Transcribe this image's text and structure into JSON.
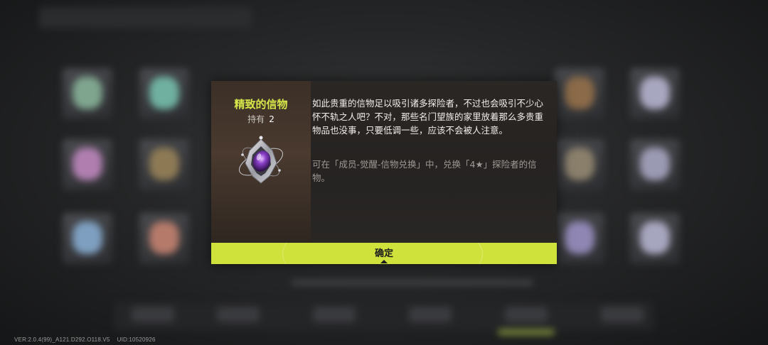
{
  "item": {
    "name": "精致的信物",
    "owned_label": "持有",
    "owned_count": "2",
    "icon": "crystal-token-icon"
  },
  "description": "如此贵重的信物足以吸引诸多探险者，不过也会吸引不少心怀不轨之人吧？不对，那些名门望族的家里放着那么多贵重物品也没事，只要低调一些，应该不会被人注意。",
  "hint": "可在「成员-觉醒-信物兑换」中，兑换「4★」探险者的信物。",
  "confirm_label": "确定",
  "footer": {
    "version": "VER:2.0.4(99)_A121.D292.O118.V5",
    "uid": "UID:10520926"
  },
  "colors": {
    "accent": "#cfe23c",
    "title": "#d8e84a",
    "panel": "#2b2724"
  }
}
